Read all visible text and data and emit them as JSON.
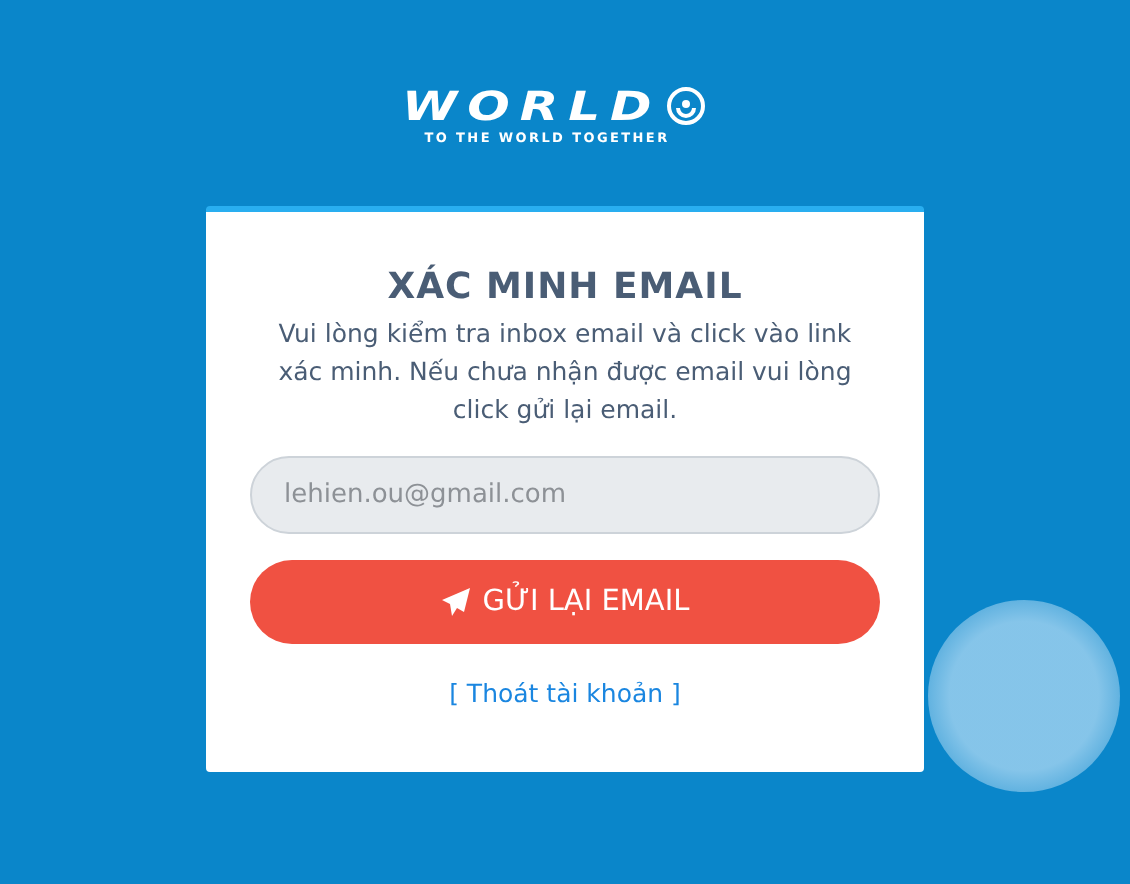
{
  "logo": {
    "name": "WORLD",
    "tagline": "TO THE WORLD TOGETHER"
  },
  "card": {
    "title": "XÁC MINH EMAIL",
    "message": "Vui lòng kiểm tra inbox email và click vào link xác minh. Nếu chưa nhận được email vui lòng click gửi lại email.",
    "email_field": {
      "value": "lehien.ou@gmail.com"
    },
    "resend_button": "GỬI LẠI EMAIL",
    "logout_link": "[ Thoát tài khoản ]"
  }
}
